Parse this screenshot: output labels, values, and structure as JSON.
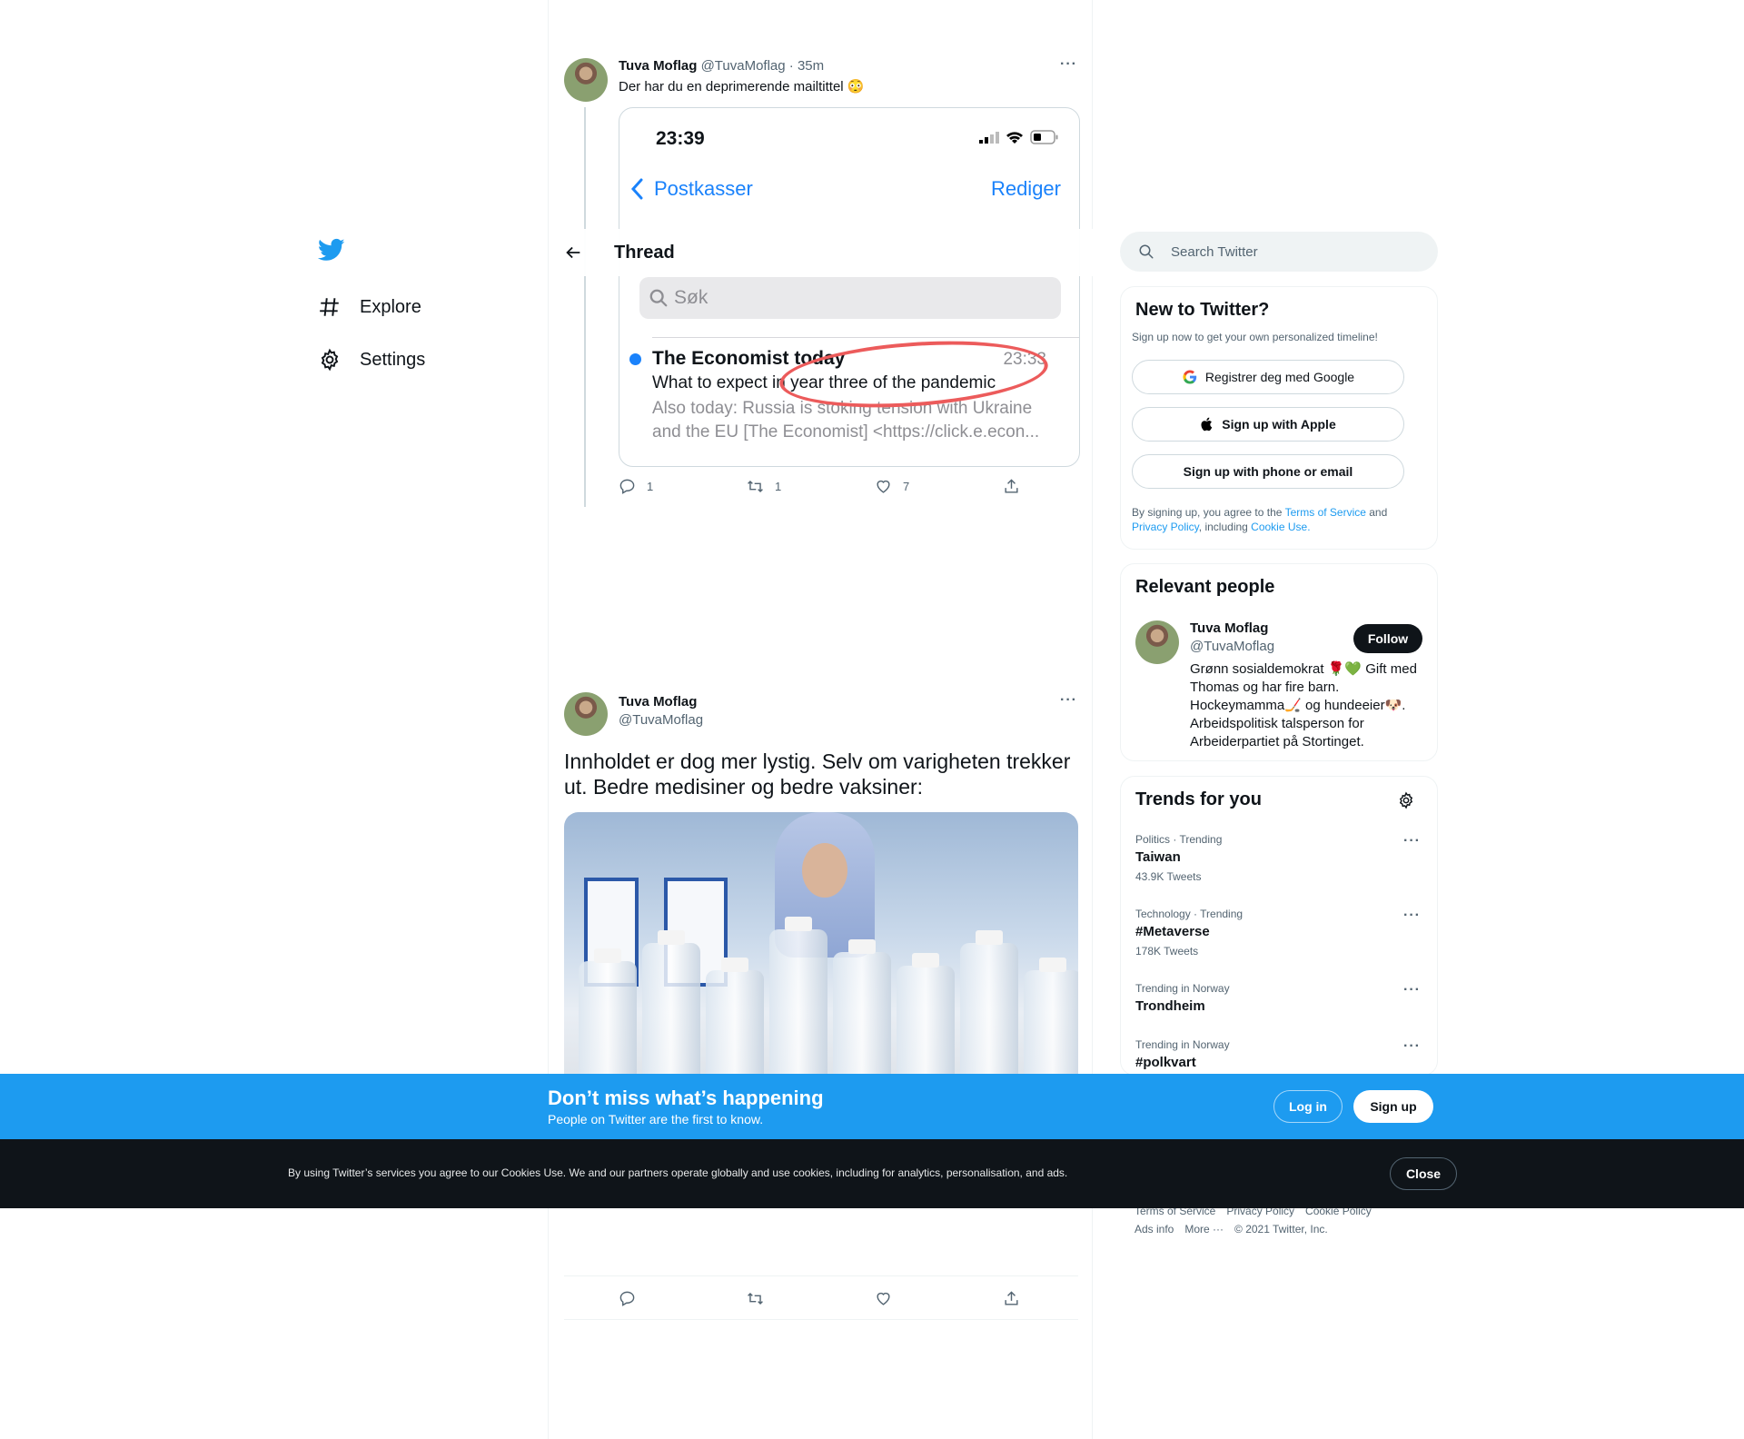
{
  "nav": {
    "items": [
      {
        "label": "Explore",
        "icon": "hashtag-icon"
      },
      {
        "label": "Settings",
        "icon": "gear-icon"
      }
    ]
  },
  "header": {
    "title": "Thread"
  },
  "tweet1": {
    "name": "Tuva Moflag",
    "handle": "@TuvaMoflag",
    "time": "· 35m",
    "text": "Der har du en deprimerende mailtittel 😳",
    "embed": {
      "time": "23:39",
      "back_label": "Postkasser",
      "edit_label": "Rediger",
      "search_placeholder": "Søk",
      "sender": "The Economist today",
      "mail_time": "23:33",
      "subject": "What to expect in year three of the pandemic",
      "preview": "Also today: Russia is stoking tension with Ukraine and the EU [The Economist] <https://click.e.econ..."
    },
    "replies": "1",
    "retweets": "1",
    "likes": "7"
  },
  "tweet2": {
    "name": "Tuva Moflag",
    "handle": "@TuvaMoflag",
    "text": "Innholdet er dog mer lystig. Selv om varigheten trekker ut. Bedre medisiner og bedre vaksiner:"
  },
  "search": {
    "placeholder": "Search Twitter"
  },
  "signup": {
    "title": "New to Twitter?",
    "subtitle": "Sign up now to get your own personalized timeline!",
    "google_label": "Registrer deg med Google",
    "apple_label": "Sign up with Apple",
    "phone_label": "Sign up with phone or email",
    "legal_prefix": "By signing up, you agree to the ",
    "terms": "Terms of Service",
    "and": " and ",
    "privacy": "Privacy Policy",
    "including": ", including ",
    "cookie": "Cookie Use."
  },
  "relevant": {
    "title": "Relevant people",
    "name": "Tuva Moflag",
    "handle": "@TuvaMoflag",
    "follow_label": "Follow",
    "bio": "Grønn sosialdemokrat 🌹💚 Gift med Thomas og har fire barn. Hockeymamma🏒 og hundeeier🐶. Arbeidspolitisk talsperson for Arbeiderpartiet på Stortinget."
  },
  "trends": {
    "title": "Trends for you",
    "items": [
      {
        "context": "Politics · Trending",
        "name": "Taiwan",
        "count": "43.9K Tweets"
      },
      {
        "context": "Technology · Trending",
        "name": "#Metaverse",
        "count": "178K Tweets"
      },
      {
        "context": "Trending in Norway",
        "name": "Trondheim",
        "count": ""
      },
      {
        "context": "Trending in Norway",
        "name": "#polkvart",
        "count": ""
      }
    ]
  },
  "footer": {
    "links1": [
      "Terms of Service",
      "Privacy Policy",
      "Cookie Policy"
    ],
    "links2": [
      "Ads info",
      "More ···",
      "© 2021 Twitter, Inc."
    ]
  },
  "banner": {
    "title": "Don’t miss what’s happening",
    "subtitle": "People on Twitter are the first to know.",
    "login_label": "Log in",
    "signup_label": "Sign up"
  },
  "cookie": {
    "text": "By using Twitter’s services you agree to our Cookies Use. We and our partners operate globally and use cookies, including for analytics, personalisation, and ads.",
    "close_label": "Close"
  },
  "colors": {
    "brand": "#1d9bf0",
    "text": "#0f1419",
    "muted": "#536471"
  }
}
